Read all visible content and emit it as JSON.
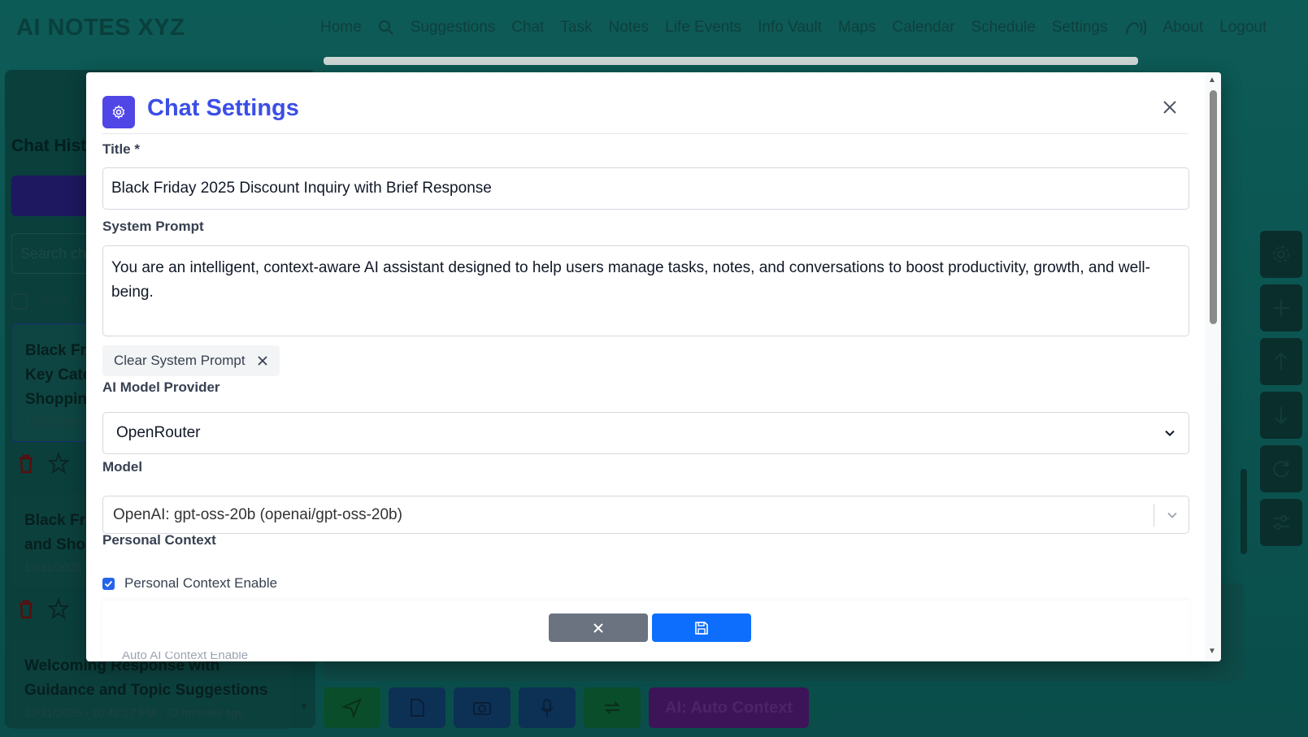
{
  "app": {
    "brand": "AI NOTES XYZ",
    "nav": [
      "Home",
      "Suggestions",
      "Chat",
      "Task",
      "Notes",
      "Life Events",
      "Info Vault",
      "Maps",
      "Calendar",
      "Schedule",
      "Settings",
      "About",
      "Logout"
    ]
  },
  "sidebar": {
    "title": "Chat Hist",
    "search_placeholder": "Search ch",
    "show_only_label": "Show o",
    "items": [
      {
        "title": "Black Fri\nKey Cate\nShoppin",
        "date": "10/31/2025"
      },
      {
        "title": "Black Fri\nand Sho",
        "date": "10/31/2025"
      },
      {
        "title": "Welcoming Response with Guidance and Topic Suggestions",
        "date": "10/31/2025 - 10:42:17 PM - 32 minutes ago"
      }
    ]
  },
  "bottombar": {
    "context_label": "AI: Auto Context"
  },
  "modal": {
    "title": "Chat Settings",
    "fields": {
      "title_label": "Title *",
      "title_value": "Black Friday 2025 Discount Inquiry with Brief Response",
      "system_prompt_label": "System Prompt",
      "system_prompt_value": "You are an intelligent, context-aware AI assistant designed to help users manage tasks, notes, and conversations to boost productivity, growth, and well-being.",
      "clear_system_prompt": "Clear System Prompt",
      "provider_label": "AI Model Provider",
      "provider_value": "OpenRouter",
      "model_label": "Model",
      "model_value": "OpenAI: gpt-oss-20b (openai/gpt-oss-20b)",
      "personal_context_label": "Personal Context",
      "personal_context_enable": "Personal Context Enable",
      "personal_context_checked": true,
      "hidden_row": "Auto AI Context Enable"
    }
  },
  "colors": {
    "accent": "#3b4ee6",
    "save": "#0d6efd",
    "cancel": "#6b7280",
    "background": "#0b4f4a"
  }
}
